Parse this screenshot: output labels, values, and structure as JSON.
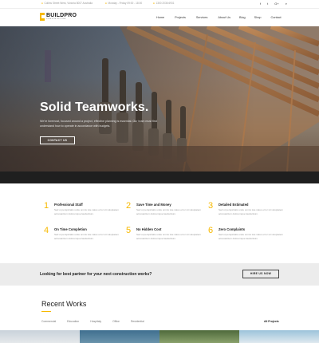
{
  "topbar": {
    "address": "Collins Street West, Victoria 8007 Australia",
    "hours": "Monday - Friday 09:00 - 18:00",
    "phone": "1300 2036 6931",
    "social": [
      {
        "icon": "facebook-icon",
        "glyph": "f"
      },
      {
        "icon": "twitter-icon",
        "glyph": "t"
      },
      {
        "icon": "google-plus-icon",
        "glyph": "G+"
      },
      {
        "icon": "search-icon",
        "glyph": "⌕"
      }
    ]
  },
  "brand": {
    "name": "BUILDPRO",
    "tagline": "CONSTRUCTION"
  },
  "nav": [
    "Home",
    "Projects",
    "Services",
    "About Us",
    "Blog",
    "Shop",
    "Contact"
  ],
  "hero": {
    "title": "Solid Teamworks.",
    "description": "We're foremost, focused around a project, effective planning is essential. Our team must first understand how to operate in accordance with budgets.",
    "button": "CONTACT US"
  },
  "features": [
    {
      "num": "1",
      "title": "Professional Staff",
      "text": "Sed ut perspiciatis unde omnis iste natus error sit voluptatem accusantium doloremque laudantium."
    },
    {
      "num": "2",
      "title": "Save Time and Money",
      "text": "Sed ut perspiciatis unde omnis iste natus error sit voluptatem accusantium doloremque laudantium."
    },
    {
      "num": "3",
      "title": "Detailed Estimated",
      "text": "Sed ut perspiciatis unde omnis iste natus error sit voluptatem accusantium doloremque laudantium."
    },
    {
      "num": "4",
      "title": "On Time Completion",
      "text": "Sed ut perspiciatis unde omnis iste natus error sit voluptatem accusantium doloremque laudantium."
    },
    {
      "num": "5",
      "title": "No Hidden Cost",
      "text": "Sed ut perspiciatis unde omnis iste natus error sit voluptatem accusantium doloremque laudantium."
    },
    {
      "num": "6",
      "title": "Zero Complaints",
      "text": "Sed ut perspiciatis unde omnis iste natus error sit voluptatem accusantium doloremque laudantium."
    }
  ],
  "cta": {
    "question": "Looking for best partner for your next construction works?",
    "button": "HIRE US NOW"
  },
  "works": {
    "heading": "Recent Works",
    "filters": [
      "Commercial",
      "Education",
      "Hospitaly",
      "Office",
      "Residential"
    ],
    "all": "All Projects"
  },
  "colors": {
    "accent": "#f7b900",
    "dark": "#1f1f1f",
    "band": "#ececec"
  }
}
